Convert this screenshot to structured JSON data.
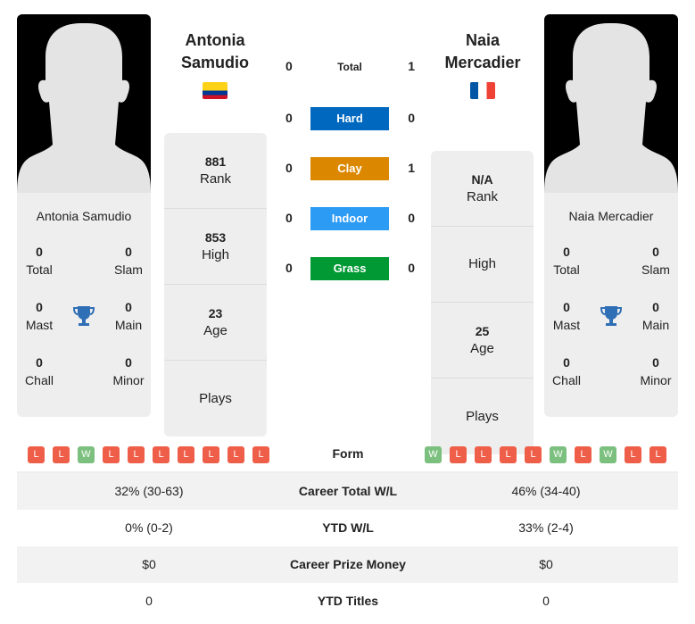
{
  "player1": {
    "name": "Antonia Samudio",
    "title_line1": "Antonia",
    "title_line2": "Samudio",
    "flag": "colombia",
    "flag_colors": [
      "#FCD116",
      "#003893",
      "#CE1126"
    ],
    "total": "0",
    "slam": "0",
    "mast": "0",
    "main": "0",
    "chall": "0",
    "minor": "0",
    "rank": "881",
    "high": "853",
    "age": "23",
    "plays": ""
  },
  "player2": {
    "name": "Naia Mercadier",
    "title_line1": "Naia",
    "title_line2": "Mercadier",
    "flag": "france",
    "flag_colors": [
      "#0055A4",
      "#FFFFFF",
      "#EF4135"
    ],
    "total": "0",
    "slam": "0",
    "mast": "0",
    "main": "0",
    "chall": "0",
    "minor": "0",
    "rank": "N/A",
    "high": "",
    "age": "25",
    "plays": ""
  },
  "labels": {
    "total": "Total",
    "slam": "Slam",
    "mast": "Mast",
    "main": "Main",
    "chall": "Chall",
    "minor": "Minor",
    "rank": "Rank",
    "high": "High",
    "age": "Age",
    "plays": "Plays"
  },
  "h2h": [
    {
      "label": "Total",
      "p1": "0",
      "p2": "1",
      "color": ""
    },
    {
      "label": "Hard",
      "p1": "0",
      "p2": "0",
      "color": "#0068BF"
    },
    {
      "label": "Clay",
      "p1": "0",
      "p2": "1",
      "color": "#DB8800"
    },
    {
      "label": "Indoor",
      "p1": "0",
      "p2": "0",
      "color": "#2B9BF4"
    },
    {
      "label": "Grass",
      "p1": "0",
      "p2": "0",
      "color": "#009933"
    }
  ],
  "form": {
    "label": "Form",
    "p1": [
      "L",
      "L",
      "W",
      "L",
      "L",
      "L",
      "L",
      "L",
      "L",
      "L"
    ],
    "p2": [
      "W",
      "L",
      "L",
      "L",
      "L",
      "W",
      "L",
      "W",
      "L",
      "L"
    ],
    "win_color": "#7CC07F",
    "loss_color": "#EE5E48"
  },
  "table": [
    {
      "label": "Career Total W/L",
      "p1": "32% (30-63)",
      "p2": "46% (34-40)"
    },
    {
      "label": "YTD W/L",
      "p1": "0% (0-2)",
      "p2": "33% (2-4)"
    },
    {
      "label": "Career Prize Money",
      "p1": "$0",
      "p2": "$0"
    },
    {
      "label": "YTD Titles",
      "p1": "0",
      "p2": "0"
    }
  ]
}
